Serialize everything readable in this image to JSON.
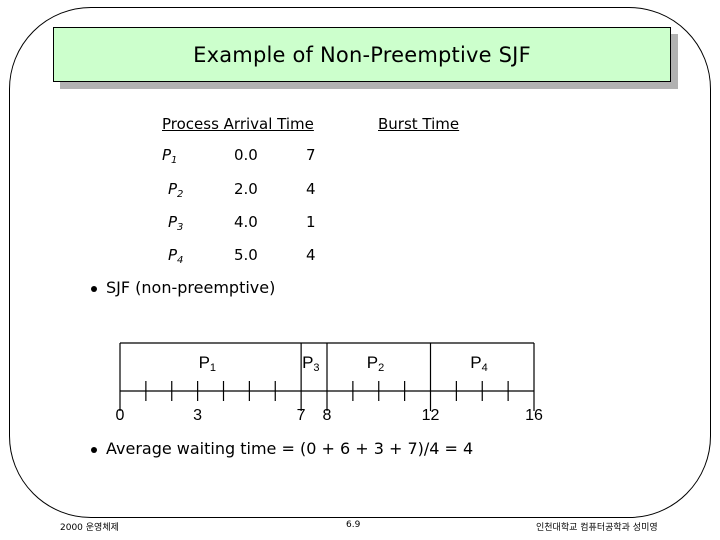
{
  "slide": {
    "title": "Example of Non-Preemptive SJF",
    "colors": {
      "title_fill": "#ccffcc",
      "title_shadow": "#b2b2b2"
    }
  },
  "table": {
    "headers": [
      "Process Arrival Time",
      "Burst Time"
    ],
    "rows": [
      {
        "process": "P",
        "sub": "1",
        "arrival": "0.0",
        "burst": "7"
      },
      {
        "process": "P",
        "sub": "2",
        "arrival": "2.0",
        "burst": "4"
      },
      {
        "process": "P",
        "sub": "3",
        "arrival": "4.0",
        "burst": "1"
      },
      {
        "process": "P",
        "sub": "4",
        "arrival": "5.0",
        "burst": "4"
      }
    ]
  },
  "bullets": [
    "SJF (non-preemptive)",
    "Average waiting time = (0 + 6 + 3 + 7)/4 = 4"
  ],
  "gantt": {
    "range": [
      0,
      16
    ],
    "segments": [
      {
        "label": "P",
        "sub": "1",
        "start": 0,
        "end": 7
      },
      {
        "label": "P",
        "sub": "3",
        "start": 7,
        "end": 8
      },
      {
        "label": "P",
        "sub": "2",
        "start": 8,
        "end": 12
      },
      {
        "label": "P",
        "sub": "4",
        "start": 12,
        "end": 16
      }
    ],
    "tick_labels": [
      "0",
      "3",
      "7",
      "8",
      "12",
      "16"
    ],
    "tick_values": [
      0,
      3,
      7,
      8,
      12,
      16
    ]
  },
  "footer": {
    "left": "2000 운영체제",
    "center": "6.9",
    "right": "인천대학교 컴퓨터공학과 성미영"
  }
}
